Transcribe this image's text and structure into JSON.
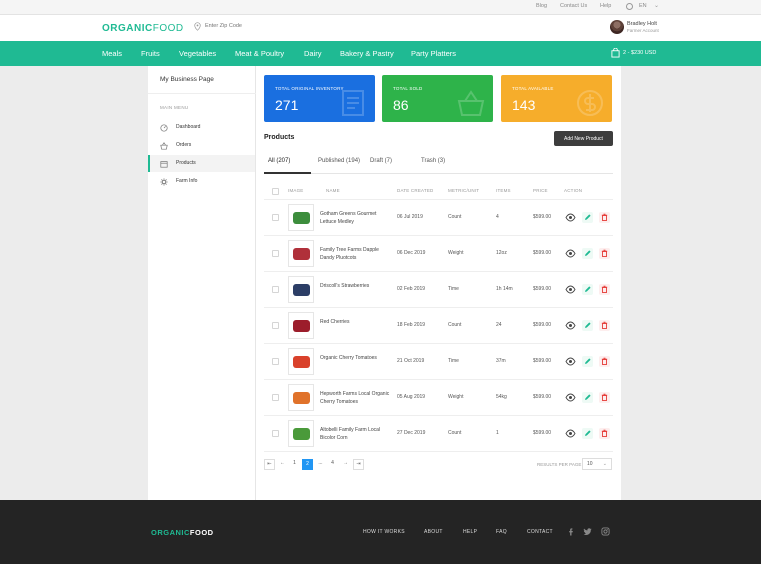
{
  "util": {
    "blog": "Blog",
    "contact": "Contact Us",
    "help": "Help",
    "lang": "EN"
  },
  "header": {
    "logo_a": "ORGANIC",
    "logo_b": "FOOD",
    "zip_placeholder": "Enter Zip Code",
    "user_name": "Bradley Holt",
    "user_role": "Farmer Account"
  },
  "nav": {
    "items": [
      "Meals",
      "Fruits",
      "Vegetables",
      "Meat & Poultry",
      "Dairy",
      "Bakery & Pastry",
      "Party Platters"
    ],
    "cart": "2 - $230 USD"
  },
  "sidebar": {
    "title": "My Business Page",
    "section": "MAIN MENU",
    "items": [
      "Dashboard",
      "Orders",
      "Products",
      "Farm Info"
    ]
  },
  "stats": [
    {
      "label": "TOTAL ORIGINAL INVENTORY",
      "value": "271",
      "color": "#1a6fe0"
    },
    {
      "label": "TOTAL SOLD",
      "value": "86",
      "color": "#2eb34a"
    },
    {
      "label": "TOTAL AVAILABLE",
      "value": "143",
      "color": "#f6ad2b"
    }
  ],
  "products": {
    "title": "Products",
    "add_button": "Add New Product",
    "tabs": [
      "All (207)",
      "Published (194)",
      "Draft (7)",
      "Trash (3)"
    ],
    "columns": [
      "IMAGE",
      "NAME",
      "DATE CREATED",
      "METRIC/UNIT",
      "ITEMS",
      "PRICE",
      "ACTION"
    ],
    "rows": [
      {
        "name": "Gotham Greens Gourmet Lettuce Medley",
        "date": "06 Jul 2019",
        "metric": "Count",
        "items": "4",
        "price": "$599.00",
        "color": "#3c8d3c"
      },
      {
        "name": "Family Tree Farms Dapple Dandy Pluotcots",
        "date": "06 Dec 2019",
        "metric": "Weight",
        "items": "12oz",
        "price": "$599.00",
        "color": "#b0303a"
      },
      {
        "name": "Driscoll's Strawberries",
        "date": "02 Feb 2019",
        "metric": "Time",
        "items": "1h 14m",
        "price": "$599.00",
        "color": "#2c3e66"
      },
      {
        "name": "Red Cherries",
        "date": "18 Feb 2019",
        "metric": "Count",
        "items": "24",
        "price": "$599.00",
        "color": "#9c1d2b"
      },
      {
        "name": "Organic Cherry Tomatoes",
        "date": "21 Oct 2019",
        "metric": "Time",
        "items": "37m",
        "price": "$599.00",
        "color": "#d9412b"
      },
      {
        "name": "Hepworth Farms Local Organic Cherry Tomatoes",
        "date": "05 Aug 2019",
        "metric": "Weight",
        "items": "54kg",
        "price": "$599.00",
        "color": "#e0722a"
      },
      {
        "name": "Altobelli Family Farm Local Bicolor Corn",
        "date": "27 Dec 2019",
        "metric": "Count",
        "items": "1",
        "price": "$599.00",
        "color": "#4a9a3a"
      }
    ]
  },
  "pagination": {
    "first": "⇤",
    "prev": "←",
    "pages": [
      "1",
      "2",
      "...",
      "4"
    ],
    "current": "2",
    "next": "→",
    "last": "⇥",
    "rpp_label": "RESULTS PER PAGE",
    "rpp_value": "10"
  },
  "footer": {
    "logo_a": "ORGANIC",
    "logo_b": "FOOD",
    "links": [
      "HOW IT WORKS",
      "ABOUT",
      "HELP",
      "FAQ",
      "CONTACT"
    ],
    "social": [
      "facebook-icon",
      "twitter-icon",
      "instagram-icon"
    ]
  }
}
